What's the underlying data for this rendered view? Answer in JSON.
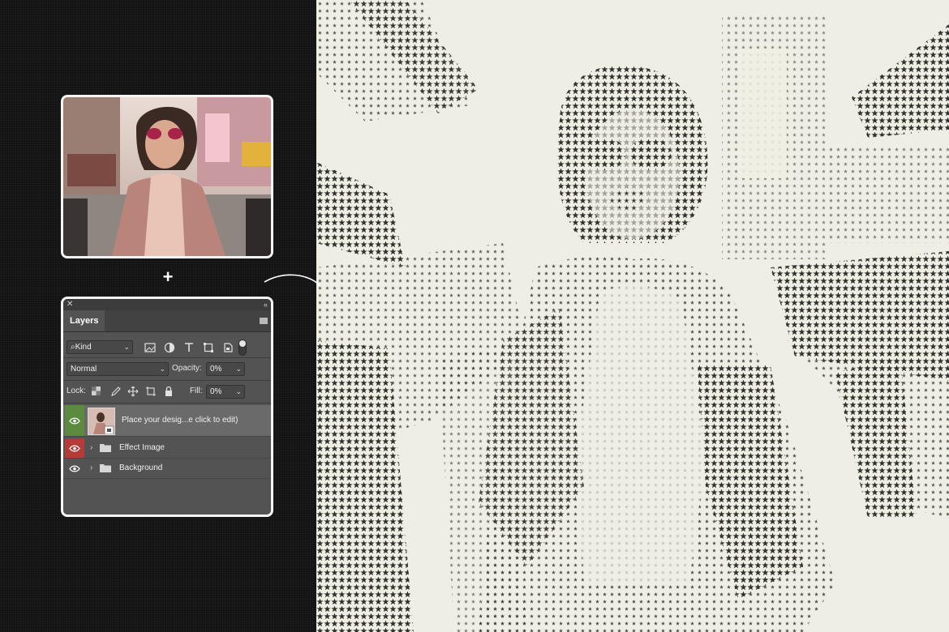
{
  "panel": {
    "tab_label": "Layers",
    "filter_label": "Kind",
    "blend_mode": "Normal",
    "opacity_label": "Opacity:",
    "opacity_value": "0%",
    "lock_label": "Lock:",
    "fill_label": "Fill:",
    "fill_value": "0%"
  },
  "layers": [
    {
      "name": "Place your desig...e click to edit)",
      "visibility": "visible-green"
    },
    {
      "name": "Effect Image",
      "visibility": "visible-red"
    },
    {
      "name": "Background",
      "visibility": "visible"
    }
  ],
  "plus_symbol": "+",
  "colors": {
    "background": "#121212",
    "paper": "#efeee4",
    "ink": "#2f312c",
    "panel_bg": "#535353",
    "eye_green": "#5c8a3f",
    "eye_red": "#b53b36"
  }
}
